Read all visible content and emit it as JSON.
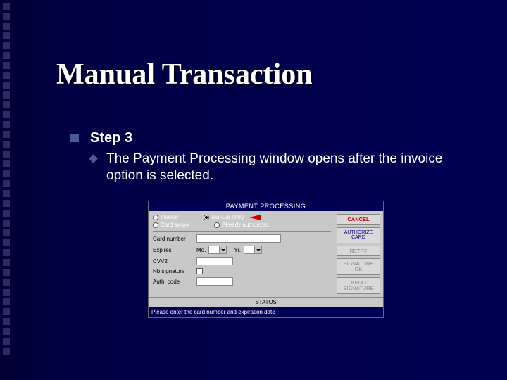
{
  "slide": {
    "title": "Manual Transaction",
    "step_label": "Step 3",
    "step_text": "The Payment Processing window opens after the invoice option is selected."
  },
  "window": {
    "title": "PAYMENT PROCESSING",
    "options": {
      "invoice": "Invoice",
      "card_swipe": "Card swipe",
      "manual_entry": "Manual entry",
      "already_authorized": "Already authorized"
    },
    "fields": {
      "card_number": "Card number",
      "expires": "Expires",
      "mo": "Mo.",
      "yr": "Yr.",
      "cvv2": "CVV2",
      "nb_signature": "Nb signature",
      "auth_code": "Auth. code"
    },
    "buttons": {
      "cancel": "CANCEL",
      "authorize_line1": "AUTHORIZE",
      "authorize_line2": "CARD",
      "retry": "RETRY",
      "sig_ok_line1": "SIGNATURE",
      "sig_ok_line2": "OK",
      "redo_line1": "REDO",
      "redo_line2": "SIGNATURE"
    },
    "status": "STATUS",
    "hint": "Please enter the card number and expiration date"
  }
}
